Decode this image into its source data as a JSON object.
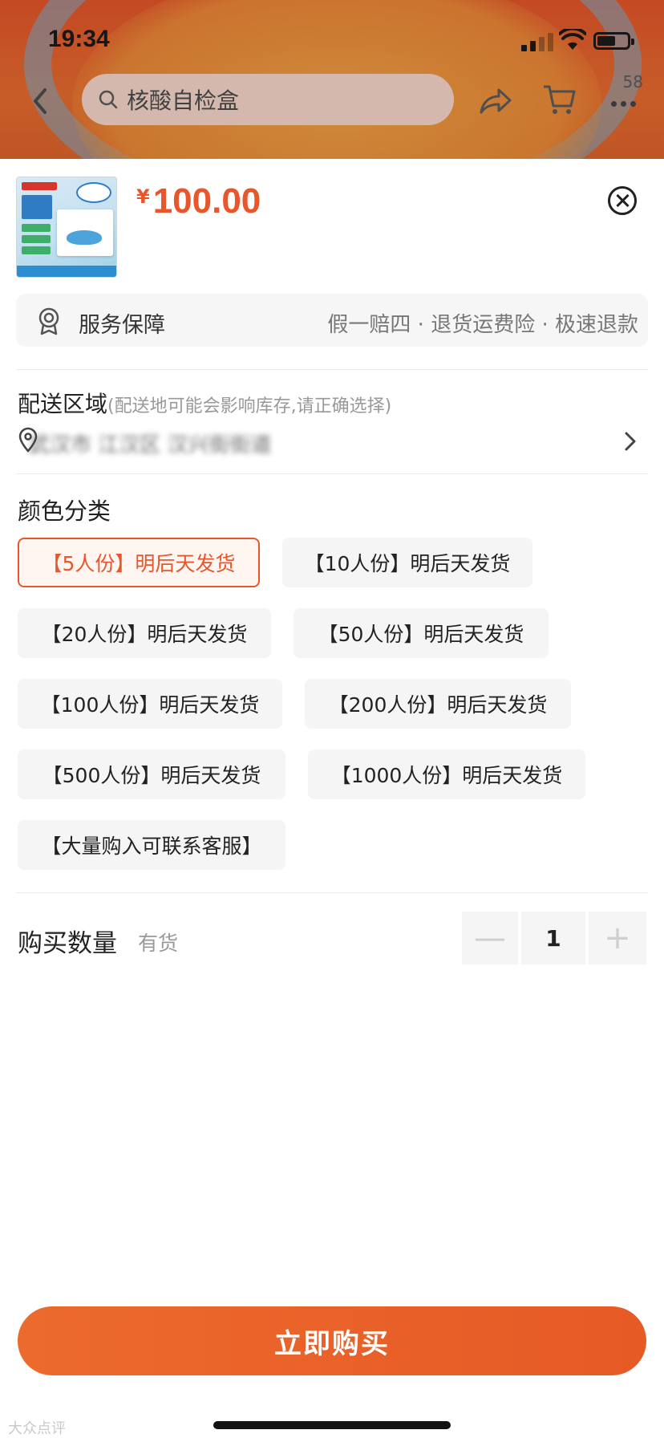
{
  "status_bar": {
    "time": "19:34"
  },
  "nav": {
    "search_text": "核酸自检盒",
    "more_count": "58"
  },
  "product": {
    "currency": "¥",
    "price": "100.00"
  },
  "service": {
    "label": "服务保障",
    "detail": "假一赔四 · 退货运费险 · 极速退款"
  },
  "delivery": {
    "title": "配送区域",
    "hint": "(配送地可能会影响库存,请正确选择)",
    "address": "武汉市 江汉区 汉兴街街道"
  },
  "color": {
    "title": "颜色分类",
    "options": [
      {
        "label": "【5人份】明后天发货",
        "selected": true
      },
      {
        "label": "【10人份】明后天发货",
        "selected": false
      },
      {
        "label": "【20人份】明后天发货",
        "selected": false
      },
      {
        "label": "【50人份】明后天发货",
        "selected": false
      },
      {
        "label": "【100人份】明后天发货",
        "selected": false
      },
      {
        "label": "【200人份】明后天发货",
        "selected": false
      },
      {
        "label": "【500人份】明后天发货",
        "selected": false
      },
      {
        "label": "【1000人份】明后天发货",
        "selected": false
      },
      {
        "label": "【大量购入可联系客服】",
        "selected": false
      }
    ]
  },
  "quantity": {
    "label": "购买数量",
    "stock": "有货",
    "minus": "—",
    "value": "1",
    "plus": "+"
  },
  "buy_button": "立即购买",
  "watermark": "大众点评",
  "colors": {
    "accent": "#e8562a",
    "button": "#e65a26"
  }
}
